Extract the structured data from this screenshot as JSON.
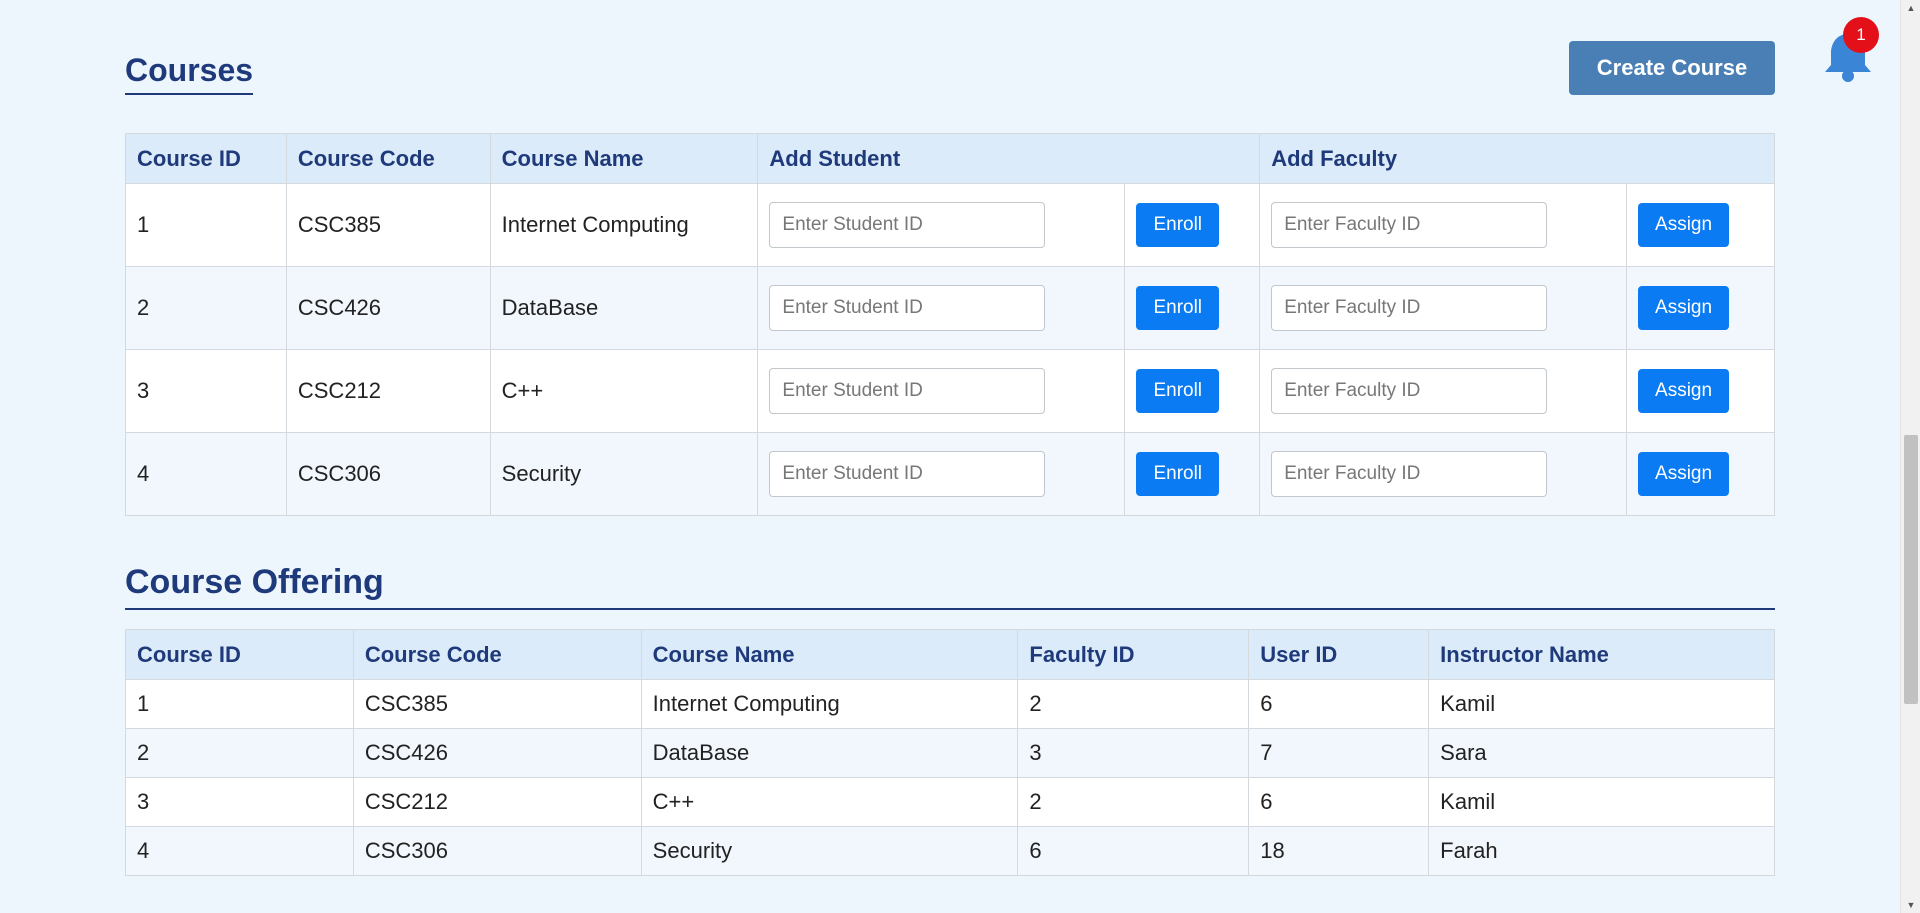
{
  "courses": {
    "title": "Courses",
    "create_label": "Create Course",
    "notification_count": "1",
    "headers": [
      "Course ID",
      "Course Code",
      "Course Name",
      "Add Student",
      "Add Faculty"
    ],
    "student_placeholder": "Enter Student ID",
    "faculty_placeholder": "Enter Faculty ID",
    "enroll_label": "Enroll",
    "assign_label": "Assign",
    "rows": [
      {
        "id": "1",
        "code": "CSC385",
        "name": "Internet Computing"
      },
      {
        "id": "2",
        "code": "CSC426",
        "name": "DataBase"
      },
      {
        "id": "3",
        "code": "CSC212",
        "name": "C++"
      },
      {
        "id": "4",
        "code": "CSC306",
        "name": "Security"
      }
    ]
  },
  "offering": {
    "title": "Course Offering",
    "headers": [
      "Course ID",
      "Course Code",
      "Course Name",
      "Faculty ID",
      "User ID",
      "Instructor Name"
    ],
    "rows": [
      {
        "id": "1",
        "code": "CSC385",
        "name": "Internet Computing",
        "faculty_id": "2",
        "user_id": "6",
        "instructor": "Kamil"
      },
      {
        "id": "2",
        "code": "CSC426",
        "name": "DataBase",
        "faculty_id": "3",
        "user_id": "7",
        "instructor": "Sara"
      },
      {
        "id": "3",
        "code": "CSC212",
        "name": "C++",
        "faculty_id": "2",
        "user_id": "6",
        "instructor": "Kamil"
      },
      {
        "id": "4",
        "code": "CSC306",
        "name": "Security",
        "faculty_id": "6",
        "user_id": "18",
        "instructor": "Farah"
      }
    ]
  },
  "colors": {
    "heading": "#1f3a7a",
    "primary_button": "#0a7bf3",
    "create_button": "#4a7fb5",
    "bell": "#3b85d6",
    "badge": "#e3101a"
  },
  "icons": {
    "notification": "bell-icon"
  }
}
